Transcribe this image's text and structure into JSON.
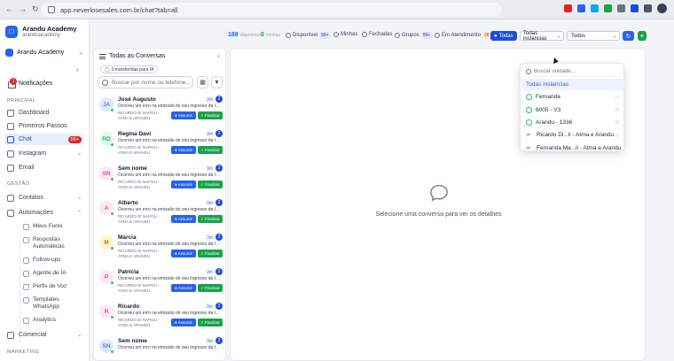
{
  "browser": {
    "url": "app.neverlosesales.com.br/chat?tab=all"
  },
  "brand": {
    "name": "Arandu Academy",
    "handle": "aranduacademy"
  },
  "account": {
    "name": "Arandu Academy"
  },
  "sidebar": {
    "notifications": {
      "label": "Notificações",
      "badge": "1"
    },
    "sections": {
      "principal": "PRINCIPAL",
      "gestao": "GESTÃO",
      "marketing": "MARKETING"
    },
    "items": [
      {
        "label": "Dashboard"
      },
      {
        "label": "Primeiros Passos"
      },
      {
        "label": "Chat",
        "badge": "99+"
      },
      {
        "label": "Instagram"
      },
      {
        "label": "Email"
      },
      {
        "label": "Contatos"
      },
      {
        "label": "Automações"
      },
      {
        "label": "Comercial"
      }
    ],
    "subitems": [
      {
        "label": "Meus Funis"
      },
      {
        "label": "Respostas Automáticas"
      },
      {
        "label": "Follow-ups"
      },
      {
        "label": "Agente de IA"
      },
      {
        "label": "Perfis de Voz"
      },
      {
        "label": "Templates WhatsApp"
      },
      {
        "label": "Analytics"
      }
    ]
  },
  "toolbar": {
    "disponiveis_count": "188",
    "disponiveis_label": "disponíveis",
    "minhas_count": "0",
    "minhas_label": "minhas",
    "disponivel": {
      "label": "Disponível",
      "badge": "99+"
    },
    "minhas": {
      "label": "Minhas"
    },
    "fechadas": {
      "label": "Fechadas"
    },
    "grupos": {
      "label": "Grupos",
      "badge": "99+"
    },
    "em_atendimento": {
      "label": "Em Atendimento",
      "badge": "38"
    },
    "todas": {
      "label": "Todas"
    },
    "instancias_select": "Todas instancias",
    "todos_select": "Todos",
    "add_label": "+"
  },
  "conversations": {
    "title": "Todas as Conversas",
    "transfer_chip": "0 transferidas para IA",
    "search_placeholder": "Buscar por nome ou telefone...",
    "assumir_label": "Assumir",
    "finalizar_label": "Finalizar",
    "items": [
      {
        "initials": "JA",
        "name": "José Augusto",
        "time": "3m",
        "count": "2",
        "message": "Ocorreu um erro na emissão do seu ingresso da Im...",
        "tag": "RICARDO DI NAPOLI - ATMA E ARANDU",
        "avatar_bg": "#dbeafe",
        "avatar_fg": "#1d4ed8"
      },
      {
        "initials": "RD",
        "name": "Regina Davi",
        "time": "3m",
        "count": "2",
        "message": "Ocorreu um erro na emissão do seu ingresso da Im...",
        "tag": "RICARDO DI NAPOLI - ATMA E ARANDU",
        "avatar_bg": "#dcfce7",
        "avatar_fg": "#15803d"
      },
      {
        "initials": "SN",
        "name": "Sem nome",
        "time": "3m",
        "count": "2",
        "message": "Ocorreu um erro na emissão do seu ingresso da Im...",
        "tag": "RICARDO DI NAPOLI - ATMA E ARANDU",
        "avatar_bg": "#fce7f3",
        "avatar_fg": "#be185d"
      },
      {
        "initials": "A",
        "name": "Alberto",
        "time": "3m",
        "count": "2",
        "message": "Ocorreu um erro na emissão do seu ingresso da Im...",
        "tag": "RICARDO DI NAPOLI - ATMA E ARANDU",
        "avatar_bg": "#fce7f3",
        "avatar_fg": "#be185d"
      },
      {
        "initials": "M",
        "name": "Márcia",
        "time": "3m",
        "count": "2",
        "message": "Ocorreu um erro na emissão do seu ingresso da Im...",
        "tag": "RICARDO DI NAPOLI - ATMA E ARANDU",
        "avatar_bg": "#fef3c7",
        "avatar_fg": "#92400e"
      },
      {
        "initials": "P",
        "name": "Patrícia",
        "time": "3m",
        "count": "2",
        "message": "Ocorreu um erro na emissão do seu ingresso da Im...",
        "tag": "RICARDO DI NAPOLI - ATMA E ARANDU",
        "avatar_bg": "#fce7f3",
        "avatar_fg": "#be185d"
      },
      {
        "initials": "R",
        "name": "Ricardo",
        "time": "3m",
        "count": "2",
        "message": "Ocorreu um erro na emissão do seu ingresso da Im...",
        "tag": "RICARDO DI NAPOLI - ATMA E ARANDU",
        "avatar_bg": "#fce7f3",
        "avatar_fg": "#be185d"
      },
      {
        "initials": "SN",
        "name": "Sem nome",
        "time": "3m",
        "count": "2",
        "message": "Ocorreu um erro na emissão do seu ingresso da Im...",
        "tag": "",
        "avatar_bg": "#dbeafe",
        "avatar_fg": "#1d4ed8"
      }
    ]
  },
  "detail": {
    "empty_text": "Selecione uma conversa para ver os detalhes"
  },
  "dropdown": {
    "search_placeholder": "Buscar unidade...",
    "items": [
      {
        "label": "Todas instancias",
        "icon": "none",
        "selected": true
      },
      {
        "label": "Fernanda",
        "icon": "whatsapp-icon"
      },
      {
        "label": "8005 - V3",
        "icon": "whatsapp-icon"
      },
      {
        "label": "Arandu - 1336",
        "icon": "whatsapp-icon"
      },
      {
        "label": "Ricardo Di...li - Atma e Arandu",
        "icon": "meta-icon"
      },
      {
        "label": "Fernanda Ma...li - Atma e Arandu",
        "icon": "meta-icon"
      }
    ]
  },
  "colors": {
    "primary": "#1d4ed8",
    "success": "#16a34a",
    "danger": "#dc2626"
  }
}
